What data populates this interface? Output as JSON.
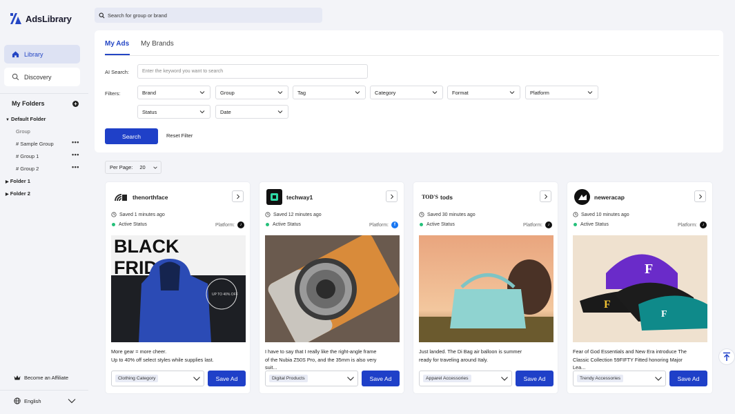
{
  "app": {
    "logo_text": "AdsLibrary"
  },
  "sidebar": {
    "nav": [
      {
        "label": "Library",
        "icon": "home-icon"
      },
      {
        "label": "Discovery",
        "icon": "search-icon"
      }
    ],
    "folders_title": "My Folders",
    "tree": {
      "default_folder": "Default Folder",
      "group_header": "Group",
      "groups": [
        "# Sample Group",
        "# Group 1",
        "# Group 2"
      ],
      "folders": [
        "Folder 1",
        "Folder 2"
      ]
    },
    "affiliate": "Become an Affiliate",
    "language": "English"
  },
  "search": {
    "placeholder": "Search for group or brand"
  },
  "panel": {
    "tabs": [
      "My Ads",
      "My Brands"
    ],
    "ai_search_label": "AI Search:",
    "ai_search_placeholder": "Enter the keyword you want to search",
    "filters_label": "Filters:",
    "filters": [
      "Brand",
      "Group",
      "Tag",
      "Category",
      "Format",
      "Platform",
      "Status",
      "Date"
    ],
    "search_button": "Search",
    "reset_button": "Reset Filter"
  },
  "per_page": {
    "label": "Per Page:",
    "value": "20"
  },
  "cards": [
    {
      "brand": "thenorthface",
      "saved": "Saved 1 minutes ago",
      "status": "Active Status",
      "platform_label": "Platform:",
      "platform_icon": "tiktok-icon",
      "description": "More gear = more cheer.\nUp to 40% off select styles while supplies last.",
      "image_text_1": "BLACK",
      "image_text_2": "FRIDAY",
      "image_badge": "UP TO 40% OFF",
      "category": "Clothing Category",
      "save_label": "Save Ad"
    },
    {
      "brand": "techway1",
      "saved": "Saved 12 minutes ago",
      "status": "Active Status",
      "platform_label": "Platform:",
      "platform_icon": "facebook-icon",
      "description": "I have to say that I really like the right-angle frame of the Nubia Z50S Pro, and the 35mm is also very suit...",
      "category": "Digital Products",
      "save_label": "Save Ad"
    },
    {
      "brand": "tods",
      "brand_logo_text": "TOD'S",
      "saved": "Saved 30 minutes ago",
      "status": "Active Status",
      "platform_label": "Platform:",
      "platform_icon": "tiktok-icon",
      "description": "Just landed. The Di Bag air balloon is summer ready for traveling around Italy.",
      "category": "Apparel Accessories",
      "save_label": "Save Ad"
    },
    {
      "brand": "neweracap",
      "saved": "Saved 10 minutes ago",
      "status": "Active Status",
      "platform_label": "Platform:",
      "platform_icon": "tiktok-icon",
      "description": "Fear of God Essentials and New Era introduce The Classic Collection 59FIFTY Fitted honoring Major Lea...",
      "category": "Trendy Accessories",
      "save_label": "Save Ad"
    }
  ],
  "colors": {
    "accent": "#1f40c8",
    "active_nav_bg": "#dde2f3",
    "status_green": "#25c07a",
    "page_bg": "#f3f4f8"
  }
}
